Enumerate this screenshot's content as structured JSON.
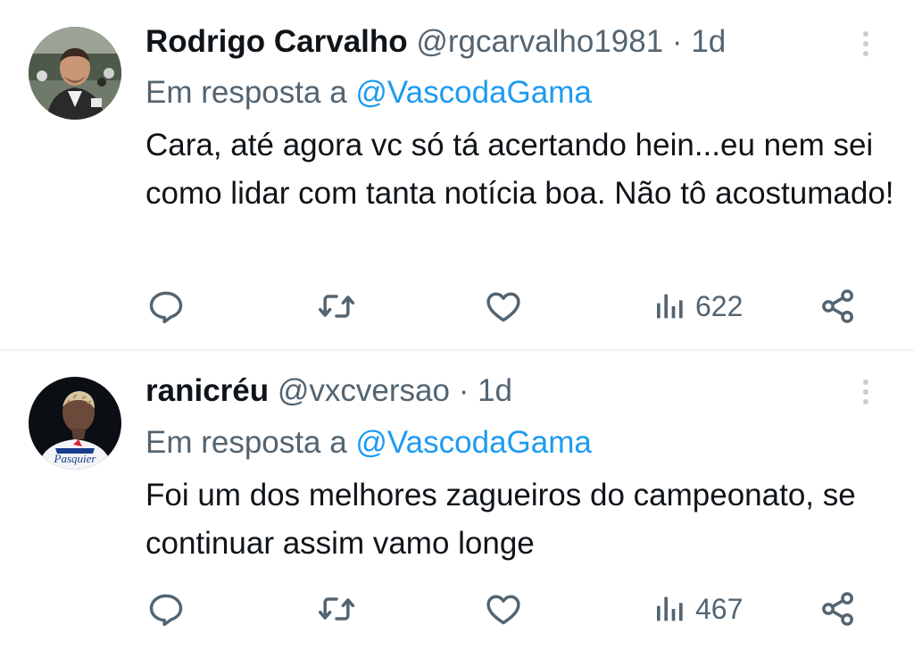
{
  "tweets": [
    {
      "name": "Rodrigo Carvalho",
      "handle": "@rgcarvalho1981",
      "separator": "·",
      "time": "1d",
      "replying_prefix": "Em resposta a",
      "replying_to": "@VascodaGama",
      "text": "Cara, até agora vc só tá acertando hein...eu nem sei como lidar com tanta notícia boa. Não tô acostumado!",
      "views": "622",
      "avatar_icon": "profile-photo-stadium"
    },
    {
      "name": "ranicréu",
      "handle": "@vxcversao",
      "separator": "·",
      "time": "1d",
      "replying_prefix": "Em resposta a",
      "replying_to": "@VascodaGama",
      "text": "Foi um dos melhores zagueiros do campeonato, se continuar assim vamo longe",
      "views": "467",
      "avatar_icon": "profile-photo-player",
      "avatar_logo_text": "Pasquier"
    }
  ],
  "icons": {
    "reply": "reply-icon",
    "retweet": "retweet-icon",
    "like": "heart-icon",
    "views": "views-icon",
    "share": "share-icon",
    "more": "more-options-icon"
  },
  "colors": {
    "text_primary": "#0f1419",
    "text_secondary": "#536471",
    "mention": "#1d9bf0",
    "divider": "#eff3f4"
  }
}
